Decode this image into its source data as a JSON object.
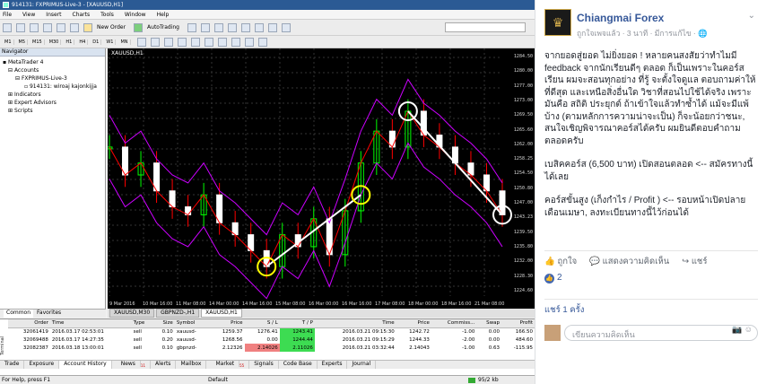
{
  "window": {
    "title": "914131: FXPRIMUS-Live-3 - [XAUUSD,H1]"
  },
  "menu": [
    "File",
    "View",
    "Insert",
    "Charts",
    "Tools",
    "Window",
    "Help"
  ],
  "toolbar": {
    "new_order": "New Order",
    "autotrading": "AutoTrading"
  },
  "timeframes": [
    "M1",
    "M5",
    "M15",
    "M30",
    "H1",
    "H4",
    "D1",
    "W1",
    "MN"
  ],
  "navigator": {
    "title": "Navigator",
    "items": [
      "MetaTrader 4",
      "Accounts",
      "FXPRIMUS-Live-3",
      "914131: wiroaj kajonkijja",
      "Indicators",
      "Expert Advisors",
      "Scripts"
    ],
    "tabs": [
      "Common",
      "Favorites"
    ]
  },
  "chart": {
    "title": "XAUUSD,H1",
    "yticks": [
      "1284.50",
      "1280.00",
      "1277.00",
      "1273.00",
      "1269.50",
      "1265.60",
      "1262.00",
      "1258.25",
      "1254.50",
      "1250.80",
      "1247.00",
      "1243.23",
      "1239.50",
      "1235.80",
      "1232.00",
      "1228.30",
      "1224.60"
    ],
    "xticks": [
      "9 Mar 2016",
      "10 Mar 16:00",
      "11 Mar 08:00",
      "14 Mar 00:00",
      "14 Mar 16:00",
      "15 Mar 08:00",
      "16 Mar 00:00",
      "16 Mar 16:00",
      "17 Mar 08:00",
      "18 Mar 00:00",
      "18 Mar 16:00",
      "21 Mar 08:00"
    ],
    "tabs": [
      "XAUUSD,M30",
      "GBPNZD-,H1",
      "XAUUSD,H1"
    ],
    "colors": {
      "bands": "#cc00ff",
      "ma": "#ff0000",
      "bull": "#00ff00",
      "annotation": "#ffffff",
      "highlight": "#ffff00"
    }
  },
  "chart_data": {
    "type": "line",
    "title": "XAUUSD,H1",
    "series": [
      {
        "name": "XAUUSD",
        "values": [
          1262,
          1255,
          1258,
          1251,
          1247,
          1245,
          1250,
          1243,
          1240,
          1236,
          1232,
          1240,
          1237,
          1244,
          1235,
          1246,
          1258,
          1266,
          1262,
          1271,
          1265,
          1262,
          1258,
          1255,
          1251,
          1245
        ]
      }
    ],
    "ylim": [
      1224.6,
      1284.5
    ]
  },
  "terminal": {
    "headers": [
      "Order",
      "Time",
      "Type",
      "Size",
      "Symbol",
      "Price",
      "S / L",
      "T / P",
      "Time",
      "Price",
      "Commiss...",
      "Swap",
      "Profit"
    ],
    "rows": [
      [
        "32061419",
        "2016.03.17 02:53:01",
        "sell",
        "0.10",
        "xauusd-",
        "1259.37",
        "1276.41",
        "1243.41",
        "2016.03.21 09:15:30",
        "1242.72",
        "-1.00",
        "0.00",
        "166.50"
      ],
      [
        "32069488",
        "2016.03.17 14:27:35",
        "sell",
        "0.20",
        "xauusd-",
        "1268.56",
        "0.00",
        "1244.44",
        "2016.03.21 09:15:29",
        "1244.33",
        "-2.00",
        "0.00",
        "484.60"
      ],
      [
        "32082387",
        "2016.03.18 13:00:01",
        "sell",
        "0.10",
        "gbpnzd-",
        "2.12326",
        "2.14026",
        "2.11026",
        "2016.03.21 03:32:44",
        "2.14043",
        "-1.00",
        "0.63",
        "-115.95"
      ]
    ],
    "tabs": [
      "Trade",
      "Exposure",
      "Account History",
      "News",
      "Alerts",
      "Mailbox",
      "Market",
      "Signals",
      "Code Base",
      "Experts",
      "Journal"
    ],
    "news_count": "11",
    "market_count": "55",
    "side_label": "Terminal"
  },
  "status": {
    "help": "For Help, press F1",
    "profile": "Default",
    "traffic": "95/2 kb"
  },
  "fb": {
    "page_name": "Chiangmai Forex",
    "meta": "ถูกใจเพจแล้ว · 3 นาที · มีการแก้ไข · 🌐",
    "post": [
      "จากยอดสู่ยอด ไม่ยิ่งยอด ! หลายคนสงสัยว่าทำไมมี feedback จากนักเรียนดีๆ ตลอด ก็เป็นเพราะในคอร์สเรียน ผมจะสอนทุกอย่าง ที่รู้ จะตั้งใจดูแล ตอบถามค่าให้ที่ดีสุด และเหนือสิ่งอื่นใด วิชาที่สอนไปใช้ได้จริง เพราะมันคือ สถิติ ประยุกต์ ถ้าเข้าใจแล้วทำซ้ำได้ แม้จะมีแพ้บ้าง (ตามหลักการความน่าจะเป็น) ก็จะน้อยกว่าชนะ, สนใจเชิญพิจารณาคอร์สได้ครับ ผมยินดีตอบคำถามตลอดครับ",
      "เบสิคคอร์ส (6,500 บาท) เปิดสอนตลอด <-- สมัครทางนี้ได้เลย",
      "คอร์สขั้นสูง (เก็งกำไร / Profit ) <-- รอบหน้าเปิดปลายเดือนเมษา, ลงทะเบียนทางนี้ไว้ก่อนได้"
    ],
    "actions": {
      "like": "ถูกใจ",
      "comment": "แสดงความคิดเห็น",
      "share": "แชร์"
    },
    "like_count": "2",
    "shares": "แชร์ 1 ครั้ง",
    "comment_placeholder": "เขียนความคิดเห็น"
  }
}
